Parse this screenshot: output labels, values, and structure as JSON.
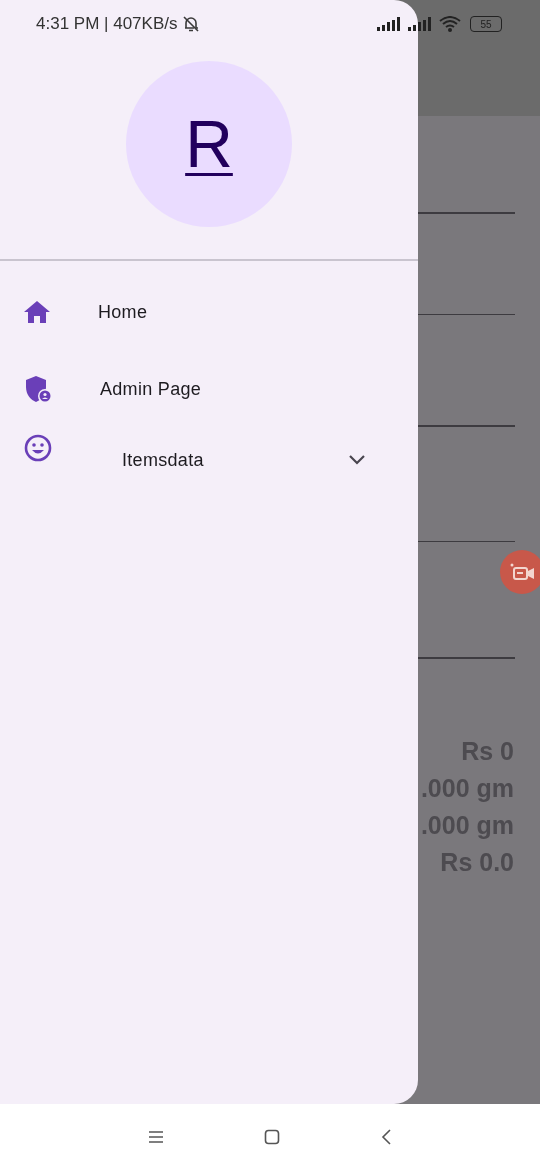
{
  "status_bar": {
    "time": "4:31 PM | 407KB/s",
    "battery": "55"
  },
  "drawer": {
    "avatar_letter": "R",
    "items": [
      {
        "kind": "home",
        "label": "Home"
      },
      {
        "kind": "admin",
        "label": "Admin Page"
      },
      {
        "kind": "group",
        "label": "Itemsdata",
        "expanded": false
      }
    ]
  },
  "background": {
    "totals": [
      "Rs 0",
      ".000 gm",
      ".000 gm",
      "Rs 0.0"
    ]
  }
}
